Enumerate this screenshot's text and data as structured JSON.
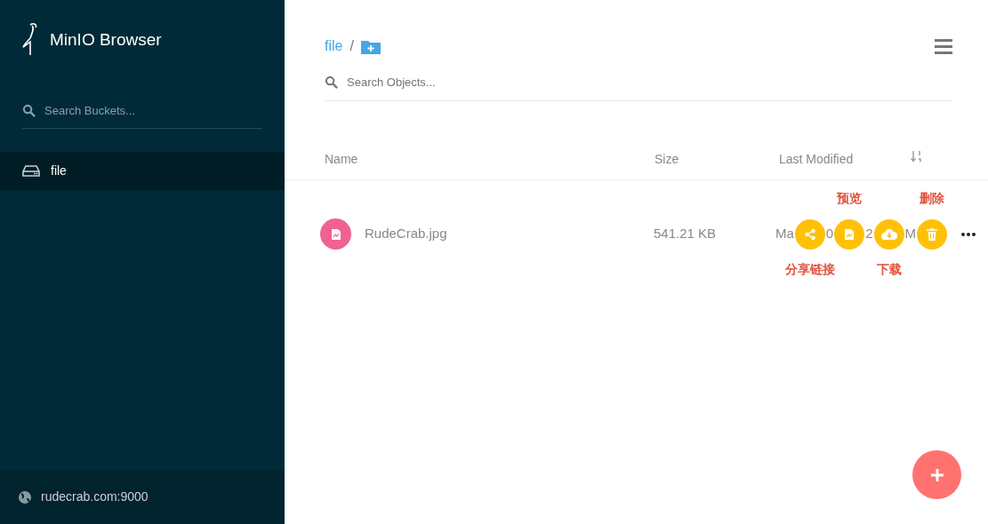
{
  "sidebar": {
    "title": "MinIO Browser",
    "search": {
      "placeholder": "Search Buckets..."
    },
    "buckets": [
      {
        "name": "file",
        "selected": true
      }
    ],
    "host": "rudecrab.com:9000"
  },
  "breadcrumb": {
    "items": [
      "file",
      "/"
    ]
  },
  "search": {
    "placeholder": "Search Objects..."
  },
  "table": {
    "columns": [
      "Name",
      "Size",
      "Last Modified"
    ],
    "rows": [
      {
        "name": "RudeCrab.jpg",
        "size": "541.21 KB",
        "modified_fragments": [
          "Ma",
          "0",
          "2",
          "M"
        ],
        "actions": [
          {
            "kind": "share",
            "note_below": "分享链接"
          },
          {
            "kind": "preview",
            "note_above": "预览"
          },
          {
            "kind": "download",
            "note_below": "下载"
          },
          {
            "kind": "delete",
            "note_above": "删除"
          }
        ]
      }
    ]
  }
}
